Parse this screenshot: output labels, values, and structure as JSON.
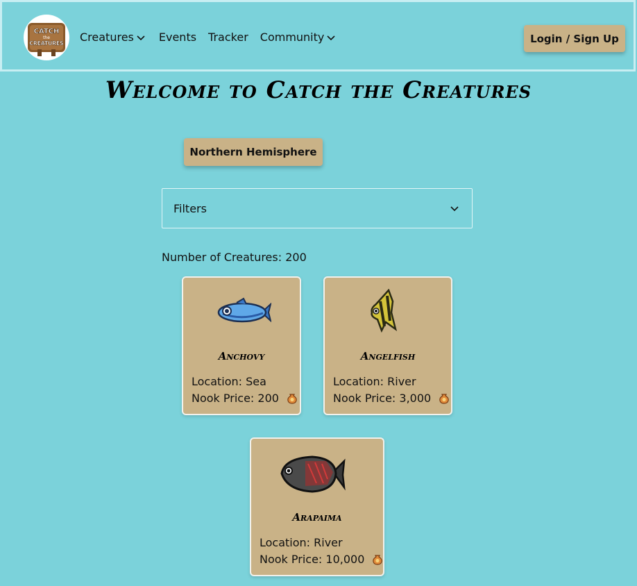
{
  "header": {
    "logo_text_top": "CATCH",
    "logo_text_mid": "the",
    "logo_text_bottom": "CREATURES",
    "nav": [
      {
        "label": "Creatures",
        "has_dropdown": true
      },
      {
        "label": "Events",
        "has_dropdown": false
      },
      {
        "label": "Tracker",
        "has_dropdown": false
      },
      {
        "label": "Community",
        "has_dropdown": true
      }
    ],
    "login_label": "Login / Sign Up"
  },
  "main": {
    "title": "Welcome to Catch the Creatures",
    "hemisphere_label": "Northern Hemisphere",
    "filters_label": "Filters",
    "count_label": "Number of Creatures: 200"
  },
  "creatures": [
    {
      "name": "Anchovy",
      "location": "Location: Sea",
      "price": "Nook Price: 200",
      "icon": "anchovy-icon"
    },
    {
      "name": "Angelfish",
      "location": "Location: River",
      "price": "Nook Price: 3,000",
      "icon": "angelfish-icon"
    },
    {
      "name": "Arapaima",
      "location": "Location: River",
      "price": "Nook Price: 10,000",
      "icon": "arapaima-icon"
    }
  ],
  "colors": {
    "background": "#7bd2da",
    "button": "#c9b287",
    "card": "#c9b287"
  }
}
